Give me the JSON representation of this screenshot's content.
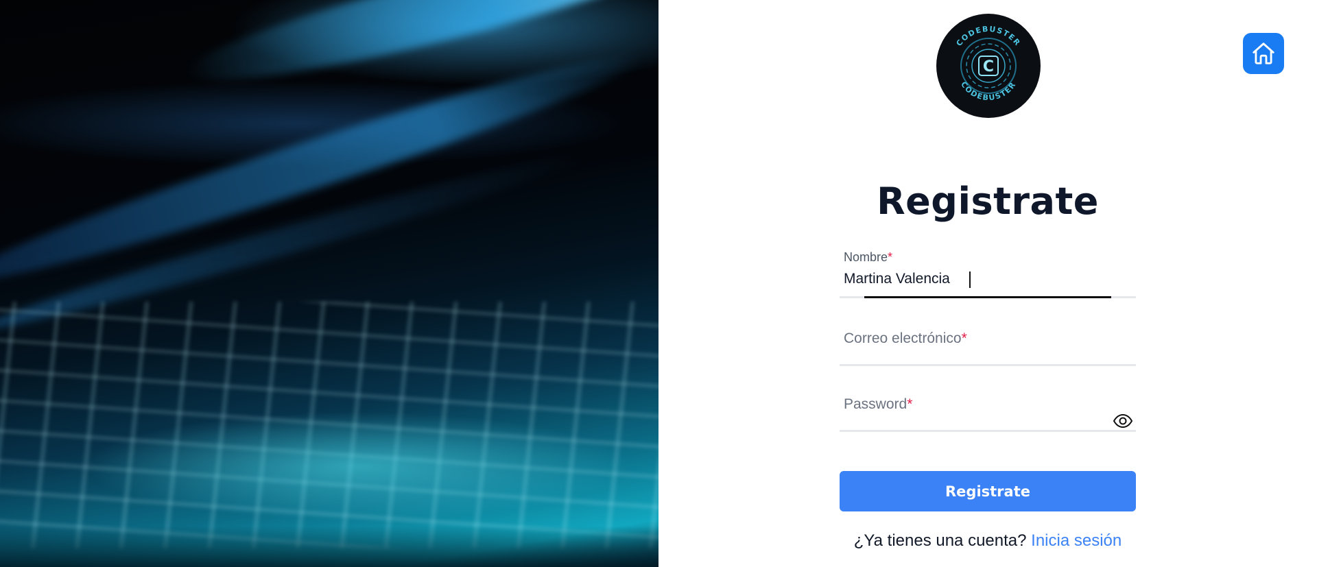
{
  "hero": {
    "image_alt": "Laptop keyboard with blue light"
  },
  "header": {
    "home_icon": "home-icon",
    "accent_color": "#1a7cf2"
  },
  "logo": {
    "text_top": "CODEBUSTER",
    "text_bottom": "CODEBUSTER",
    "letter": "C"
  },
  "form": {
    "title": "Registrate",
    "name_field": {
      "label": "Nombre",
      "required_mark": "*",
      "value": "Martina Valencia"
    },
    "email_field": {
      "label": "Correo electrónico",
      "required_mark": "*",
      "value": ""
    },
    "password_field": {
      "label": "Password",
      "required_mark": "*",
      "value": "",
      "toggle_icon": "eye-icon"
    },
    "submit_label": "Registrate",
    "submit_color": "#3b82f6",
    "footer": {
      "prompt": "¿Ya tienes una cuenta?",
      "link": "Inicia sesión"
    }
  }
}
